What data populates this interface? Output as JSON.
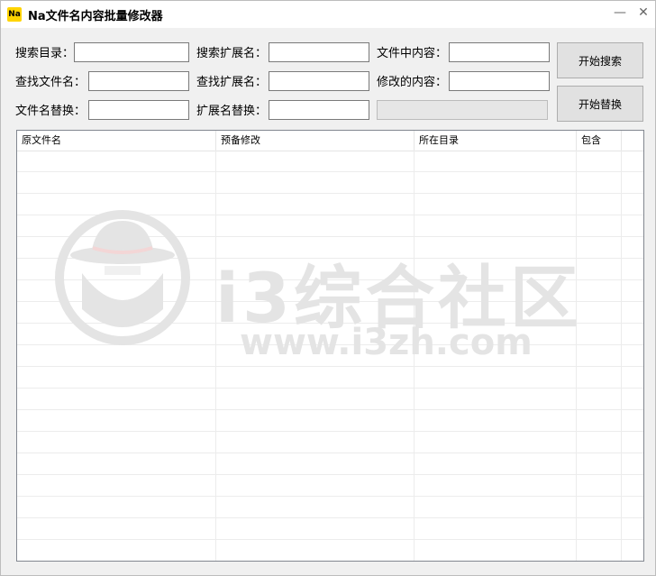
{
  "window": {
    "app_icon_text": "Na",
    "title": "Na文件名内容批量修改器",
    "minimize_glyph": "—",
    "close_glyph": "✕"
  },
  "form": {
    "search_dir": {
      "label": "搜索目录：",
      "value": ""
    },
    "search_ext": {
      "label": "搜索扩展名：",
      "value": ""
    },
    "file_content": {
      "label": "文件中内容：",
      "value": ""
    },
    "find_filename": {
      "label": "查找文件名：",
      "value": ""
    },
    "find_ext": {
      "label": "查找扩展名：",
      "value": ""
    },
    "modified_content": {
      "label": "修改的内容：",
      "value": ""
    },
    "filename_replace": {
      "label": "文件名替换：",
      "value": ""
    },
    "ext_replace": {
      "label": "扩展名替换：",
      "value": ""
    }
  },
  "progress": {
    "value": 0
  },
  "buttons": {
    "start_search": "开始搜索",
    "start_replace": "开始替换"
  },
  "table": {
    "columns": [
      "原文件名",
      "预备修改",
      "所在目录",
      "包含"
    ],
    "rows": []
  },
  "watermark": {
    "text": "i3综合社区",
    "url": "www.i3zh.com"
  }
}
